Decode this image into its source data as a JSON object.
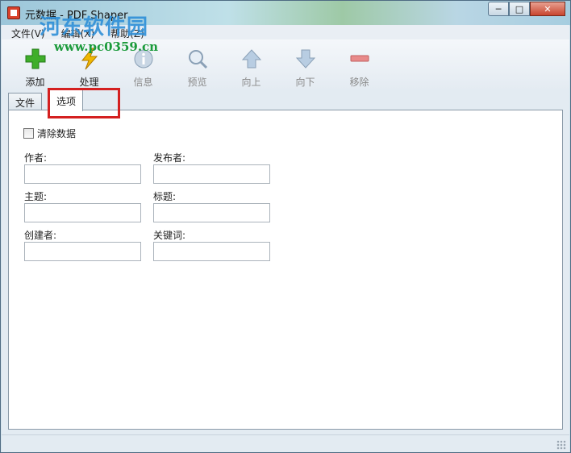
{
  "window": {
    "title": "元数据 - PDF Shaper",
    "minimize": "─",
    "maximize": "□",
    "close": "✕"
  },
  "watermark": {
    "logo_text": "河东软件园",
    "url": "www.pc0359.cn"
  },
  "menu": {
    "items": [
      "文件(V)",
      "编辑(X)",
      "帮助(Z)"
    ]
  },
  "toolbar": {
    "add": "添加",
    "process": "处理",
    "info": "信息",
    "preview": "预览",
    "up": "向上",
    "down": "向下",
    "remove": "移除"
  },
  "tabs": {
    "file": "文件",
    "options": "选项"
  },
  "options": {
    "clear_data": "清除数据",
    "author_label": "作者:",
    "author_value": "",
    "publisher_label": "发布者:",
    "publisher_value": "",
    "subject_label": "主题:",
    "subject_value": "",
    "title_label": "标题:",
    "title_value": "",
    "creator_label": "创建者:",
    "creator_value": "",
    "keywords_label": "关键词:",
    "keywords_value": ""
  },
  "colors": {
    "highlight": "#d42020",
    "add_icon": "#3fae2a",
    "process_icon": "#f0b800"
  }
}
